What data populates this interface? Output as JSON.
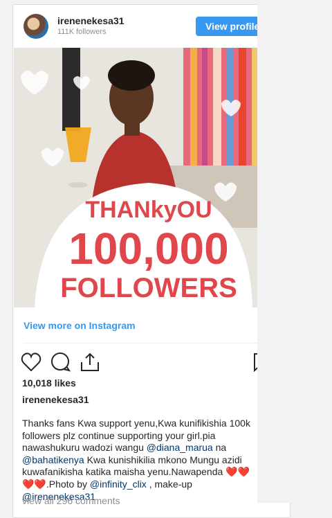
{
  "header": {
    "username": "irenenekesa31",
    "followers": "111K followers",
    "view_profile_label": "View profile"
  },
  "post": {
    "banner_line1": "THANkyOU",
    "banner_line2": "100,000",
    "banner_line3": "FOLLOWERS",
    "view_more_label": "View more on Instagram",
    "likes": "10,018 likes",
    "author": "irenenekesa31",
    "caption": {
      "text1": "Thanks fans Kwa support yenu,Kwa kunifikishia 100k followers plz continue supporting your girl.pia nawashukuru wadozi wangu ",
      "mention1": "@diana_marua",
      "text2": " na ",
      "mention2": "@bahatikenya",
      "text3": " Kwa kunishikilia mkono Mungu azidi kuwafanikisha katika maisha yenu.Nawapenda ❤️❤️❤️❤️.Photo by ",
      "mention3": "@infinity_clix",
      "text4": " , make-up ",
      "mention4": "@irenenekesa31"
    },
    "comments": "view all 296 comments"
  },
  "colors": {
    "accent": "#3897f0",
    "banner_red": "#e0474c",
    "mention": "#00376b"
  }
}
